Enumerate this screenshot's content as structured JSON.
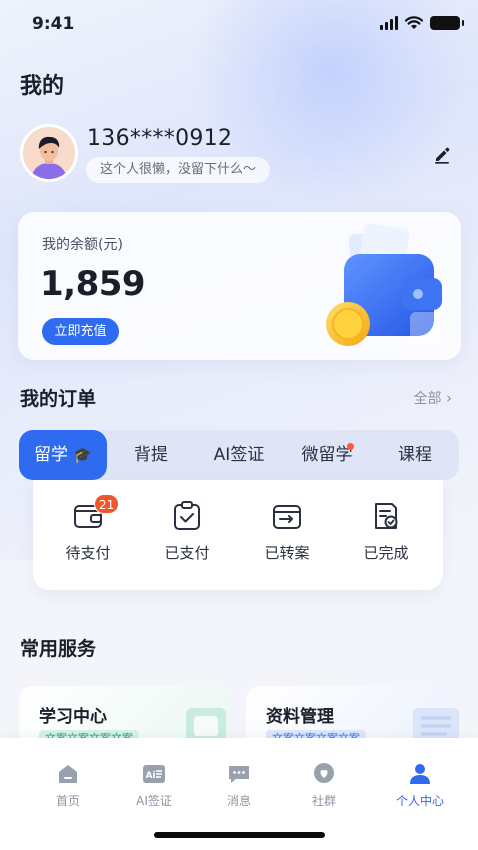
{
  "status_bar": {
    "time": "9:41"
  },
  "page": {
    "title": "我的"
  },
  "profile": {
    "phone": "136****0912",
    "bio": "这个人很懒，没留下什么～"
  },
  "balance": {
    "label": "我的余额(元)",
    "value": "1,859",
    "recharge_label": "立即充值"
  },
  "orders": {
    "title": "我的订单",
    "all_label": "全部",
    "tabs": [
      {
        "label": "留学",
        "active": true
      },
      {
        "label": "背提",
        "active": false
      },
      {
        "label": "AI签证",
        "active": false
      },
      {
        "label": "微留学",
        "active": false,
        "dot": true
      },
      {
        "label": "课程",
        "active": false
      }
    ],
    "statuses": [
      {
        "label": "待支付",
        "icon": "wallet-icon",
        "badge": "21"
      },
      {
        "label": "已支付",
        "icon": "clipboard-check-icon"
      },
      {
        "label": "已转案",
        "icon": "transfer-box-icon"
      },
      {
        "label": "已完成",
        "icon": "document-check-icon"
      }
    ]
  },
  "services": {
    "title": "常用服务",
    "items": [
      {
        "title": "学习中心",
        "tag": "文案文案文案文案"
      },
      {
        "title": "资料管理",
        "tag": "文案文案文案文案"
      }
    ]
  },
  "tabbar": {
    "items": [
      {
        "label": "首页",
        "icon": "home-icon",
        "active": false
      },
      {
        "label": "AI签证",
        "icon": "ai-visa-icon",
        "active": false
      },
      {
        "label": "消息",
        "icon": "message-icon",
        "active": false
      },
      {
        "label": "社群",
        "icon": "community-icon",
        "active": false
      },
      {
        "label": "个人中心",
        "icon": "user-icon",
        "active": true
      }
    ]
  },
  "colors": {
    "primary": "#2f6bf0",
    "badge": "#f0552b",
    "tab_inactive": "#8e94a2"
  }
}
